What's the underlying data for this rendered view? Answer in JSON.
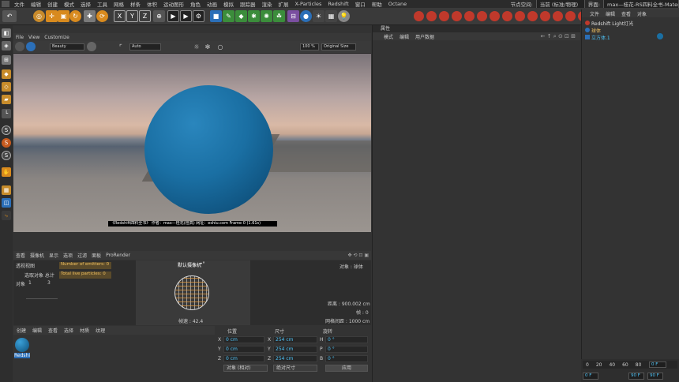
{
  "menubar": {
    "items": [
      "文件",
      "编辑",
      "创建",
      "模式",
      "选择",
      "工具",
      "网格",
      "样条",
      "体积",
      "运动图形",
      "角色",
      "动画",
      "模拟",
      "跟踪器",
      "渲染",
      "扩展",
      "X-Particles",
      "Redshift",
      "窗口",
      "帮助",
      "Octane"
    ],
    "node_space_label": "节点空间:",
    "node_space_value": "当前 (标准/物理)",
    "interface_label": "界面:",
    "interface_value": "max—桂花-RS四料全书-Material (用户)"
  },
  "toolbar": {
    "xyz": [
      "X",
      "Y",
      "Z"
    ]
  },
  "viewport": {
    "menu": [
      "查看",
      "摄像机",
      "显示",
      "选项",
      "过滤",
      "面板",
      "ProRender"
    ],
    "menu_top": [
      "File",
      "View",
      "Customize"
    ],
    "render_mode": "Beauty",
    "auto_label": "Auto",
    "zoom_label": "100 % ",
    "size_label": "Original Size",
    "caption": "《Redshift四料全书》 作者：max—桂花(桂高) 网址：eshiu.com Frame 0 (1.61s)"
  },
  "motion_graph": {
    "menu": [
      "查看",
      "摄像机",
      "显示",
      "选项",
      "过滤",
      "面板",
      "ProRender"
    ],
    "left_title": "透视视图",
    "row1": "选取对象 总计",
    "row2_label": "对象",
    "row2_a": "1",
    "row2_b": "3",
    "emitters": "Number of emitters: 0",
    "particles": "Total live particles: 0",
    "camera": "默认摄像机",
    "camera_icon": "•°",
    "object_label": "对象 : 球体",
    "distance": "距离 : 900.002 cm",
    "frame": "帧 : 0",
    "grid": "网格间距 : 1000 cm",
    "fps": "帧速 : 42.4"
  },
  "material": {
    "menu": [
      "创建",
      "编辑",
      "查看",
      "选择",
      "材质",
      "纹理"
    ],
    "material_name": "Redshi"
  },
  "coords": {
    "headers": [
      "位置",
      "尺寸",
      "旋转"
    ],
    "rows": [
      {
        "axis": "X",
        "pos": "0 cm",
        "size_axis": "X",
        "size": "254 cm",
        "rot_axis": "H",
        "rot": "0 °"
      },
      {
        "axis": "Y",
        "pos": "0 cm",
        "size_axis": "Y",
        "size": "254 cm",
        "rot_axis": "P",
        "rot": "0 °"
      },
      {
        "axis": "Z",
        "pos": "0 cm",
        "size_axis": "Z",
        "size": "254 cm",
        "rot_axis": "B",
        "rot": "0 °"
      }
    ],
    "mode": "对象 (相对)",
    "size_mode": "绝对尺寸",
    "apply": "应用"
  },
  "attributes": {
    "title": "属性",
    "menu": [
      "模式",
      "编辑",
      "用户数据"
    ]
  },
  "objects": {
    "menu": [
      "文件",
      "编辑",
      "查看",
      "对象"
    ],
    "items": [
      "Redshift Light灯光",
      "球体",
      "立方体.1"
    ]
  },
  "timeline": {
    "ticks": [
      "0",
      "20",
      "40",
      "60",
      "80"
    ],
    "current_frame": "0 F",
    "start": "0 F",
    "end": "90 F",
    "end2": "90 F"
  },
  "colors": {
    "sphere": "#1a6fa3",
    "accent": "#4fc3f7",
    "red_icon": "#c0392b"
  }
}
